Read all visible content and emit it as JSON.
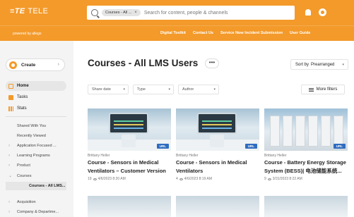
{
  "header": {
    "logo_mark": "≡TE",
    "logo_text": "TELE",
    "search_chip": "Courses - All ...",
    "search_chip_close": "×",
    "search_placeholder": "Search for content, people & channels"
  },
  "subheader": {
    "powered_by": "powered by allego",
    "links": [
      "Digital Toolkit",
      "Contact Us",
      "Service Now Incident Submission",
      "User Guide"
    ]
  },
  "sidebar": {
    "create_label": "Create",
    "primary": [
      {
        "label": "Home",
        "icon": "home-icon",
        "active": true
      },
      {
        "label": "Tasks",
        "icon": "tasks-icon",
        "active": false
      },
      {
        "label": "Stats",
        "icon": "stats-icon",
        "active": false
      }
    ],
    "secondary": [
      {
        "label": "Shared With You"
      },
      {
        "label": "Recently Viewed"
      },
      {
        "label": "Application Focused ..."
      },
      {
        "label": "Learning Programs"
      },
      {
        "label": "Product"
      },
      {
        "label": "Courses"
      },
      {
        "label": "Courses - All LMS..."
      },
      {
        "label": "Acquisition"
      },
      {
        "label": "Company & Departme..."
      }
    ]
  },
  "main": {
    "title": "Courses - All LMS Users",
    "more_label": "•••",
    "sort_prefix": "Sort by",
    "sort_value": "Prearranged",
    "filters": [
      "Share date",
      "Type",
      "Author"
    ],
    "more_filters": "More filters",
    "cards": [
      {
        "author": "Brittany Heller",
        "title_line1": "Course - Sensors in Medical",
        "title_line2": "Ventilators – Customer Version",
        "views": "19",
        "date": "4/6/2023 8:20 AM",
        "badge": "URL"
      },
      {
        "author": "Brittany Heller",
        "title_line1": "Course - Sensors in Medical",
        "title_line2": "Ventilators",
        "views": "4",
        "date": "4/6/2023 8:19 AM",
        "badge": "URL"
      },
      {
        "author": "Brittany Heller",
        "title_line1": "Course - Battery Energy Storage",
        "title_line2": "System (BESS)| 电池储能系统...",
        "views": "9",
        "date": "3/31/2023 8:22 AM",
        "badge": "URL"
      }
    ]
  },
  "colors": {
    "brand": "#f39a2b",
    "badge": "#2f6cc0"
  }
}
